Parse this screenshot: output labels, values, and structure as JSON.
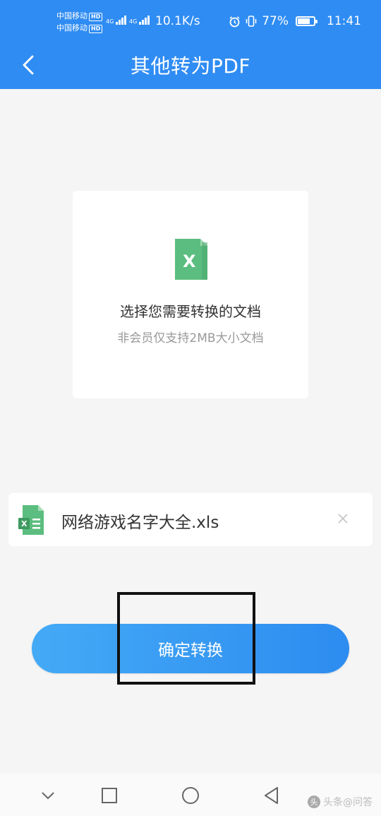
{
  "status_bar": {
    "carrier_1": "中国移动",
    "carrier_2": "中国移动",
    "hd_badge": "HD",
    "network_1": "4G",
    "network_2": "4G",
    "net_speed": "10.1K/s",
    "battery_percent": "77%",
    "battery_level": 0.77,
    "time": "11:41",
    "icons": [
      "alarm-icon",
      "vibrate-icon",
      "battery-icon"
    ]
  },
  "header": {
    "title": "其他转为PDF",
    "back_icon": "chevron-left-icon",
    "background": "#2f8cf3"
  },
  "upload_card": {
    "icon": "excel-file-icon",
    "icon_letter": "X",
    "title": "选择您需要转换的文档",
    "subtitle": "非会员仅支持2MB大小文档"
  },
  "file": {
    "icon": "excel-file-icon",
    "icon_letter": "X",
    "name": "网络游戏名字大全.xls",
    "remove_icon": "close-icon"
  },
  "convert_button": {
    "label": "确定转换"
  },
  "system_nav": {
    "items": [
      "chevron-down-icon",
      "square-icon",
      "circle-icon",
      "triangle-back-icon"
    ],
    "watermark": "头条@问答"
  },
  "colors": {
    "accent": "#2f8cf3",
    "excel_green": "#5bbd7f",
    "text_primary": "#333333",
    "text_secondary": "#999999"
  }
}
